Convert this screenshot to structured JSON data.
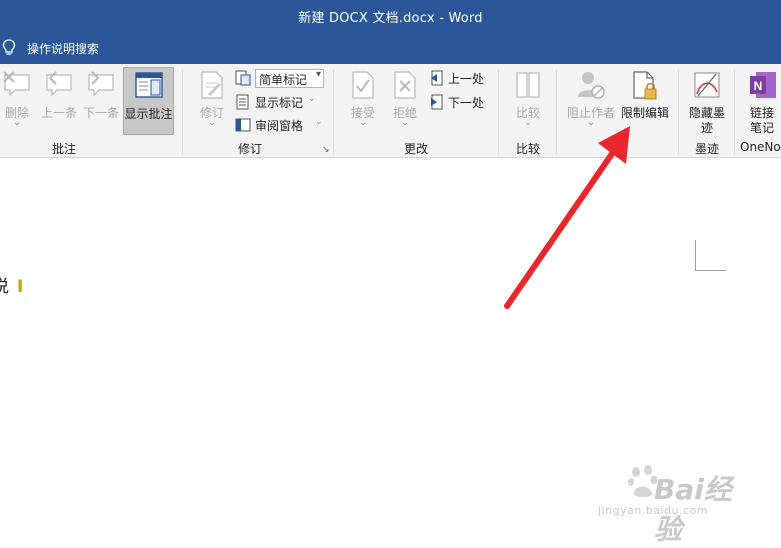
{
  "window": {
    "title": "新建 DOCX 文档.docx  -  Word"
  },
  "tellme": {
    "label": "操作说明搜索"
  },
  "ribbon": {
    "comments": {
      "group_label": "批注",
      "delete": "删除",
      "previous": "上一条",
      "next": "下一条",
      "show_comments": "显示批注"
    },
    "tracking": {
      "group_label": "修订",
      "track_changes": "修订",
      "markup_dropdown": "简单标记",
      "show_markup": "显示标记",
      "reviewing_pane": "审阅窗格"
    },
    "changes": {
      "group_label": "更改",
      "accept": "接受",
      "reject": "拒绝",
      "previous": "上一处",
      "next": "下一处"
    },
    "compare": {
      "group_label": "比较",
      "compare": "比较"
    },
    "protect": {
      "group_label": "护",
      "block_authors": "阻止作者",
      "restrict_editing": "限制编辑"
    },
    "ink": {
      "group_label": "墨迹",
      "hide_ink_line1": "隐藏墨",
      "hide_ink_line2": "迹"
    },
    "onenote": {
      "group_label": "OneNo",
      "linked_notes_line1": "链接",
      "linked_notes_line2": "笔记"
    }
  },
  "document": {
    "cursor_text": "说"
  },
  "watermark": {
    "brand": "Bai经验",
    "url": "jingyan.baidu.com"
  },
  "colors": {
    "title_bar": "#2b579a",
    "ribbon_bg": "#f3f3f3",
    "arrow": "#e8262b",
    "onenote_purple": "#7b3fa0"
  }
}
